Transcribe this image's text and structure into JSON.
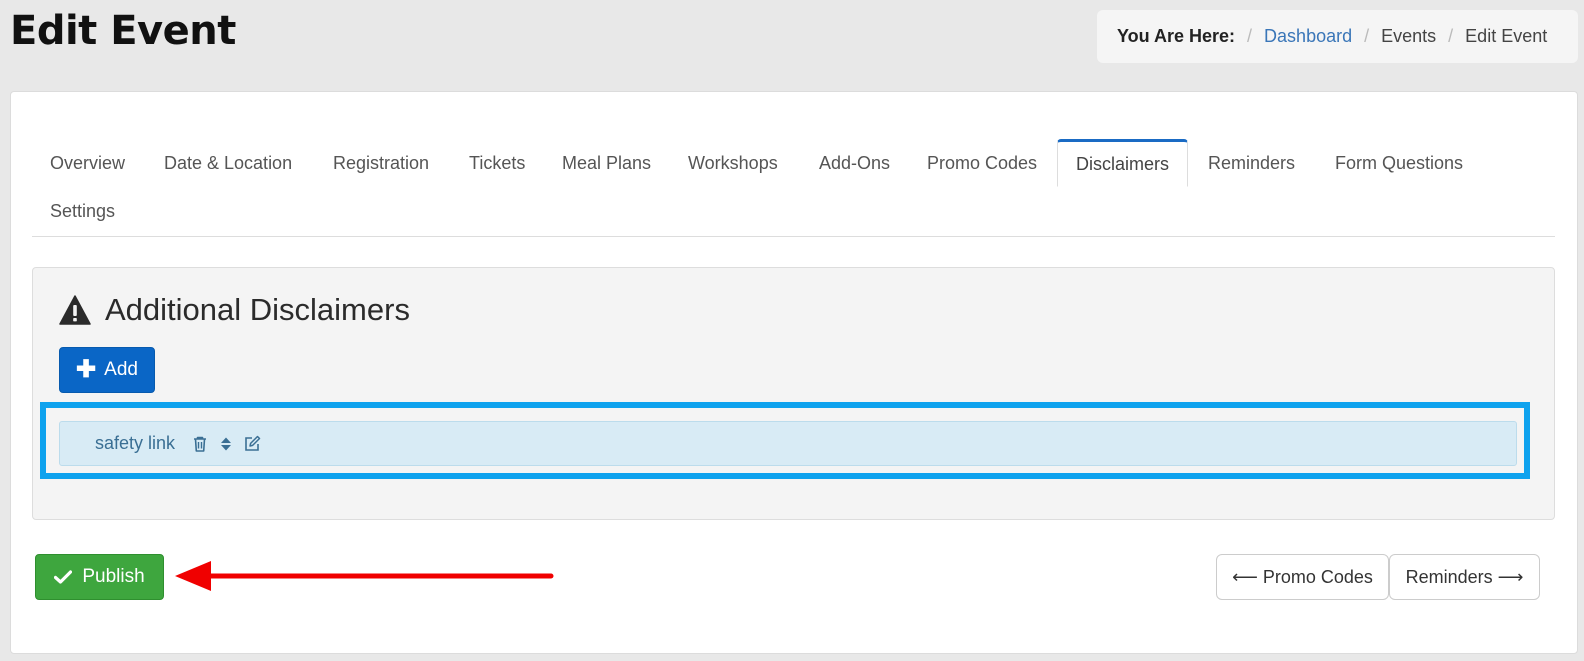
{
  "page": {
    "title": "Edit Event"
  },
  "breadcrumb": {
    "label": "You Are Here:",
    "items": [
      {
        "text": "Dashboard",
        "link": true
      },
      {
        "text": "Events",
        "link": false
      },
      {
        "text": "Edit Event",
        "link": false
      }
    ]
  },
  "tabs": [
    {
      "label": "Overview"
    },
    {
      "label": "Date & Location"
    },
    {
      "label": "Registration"
    },
    {
      "label": "Tickets"
    },
    {
      "label": "Meal Plans"
    },
    {
      "label": "Workshops"
    },
    {
      "label": "Add-Ons"
    },
    {
      "label": "Promo Codes"
    },
    {
      "label": "Disclaimers",
      "active": true
    },
    {
      "label": "Reminders"
    },
    {
      "label": "Form Questions"
    },
    {
      "label": "Settings"
    }
  ],
  "panel": {
    "icon": "warning-icon",
    "title": "Additional Disclaimers",
    "add_label": "Add"
  },
  "disclaimers": [
    {
      "label": "safety link",
      "icons": [
        "trash-icon",
        "sort-icon",
        "edit-icon"
      ]
    }
  ],
  "actions": {
    "publish_label": "Publish",
    "prev_label": "⟵ Promo Codes",
    "next_label": "Reminders ⟶"
  },
  "colors": {
    "primary": "#0a66c6",
    "success": "#3ea63e",
    "highlight": "#0ea2ee",
    "annotation_arrow": "#f00000",
    "link": "#3a76b8"
  }
}
